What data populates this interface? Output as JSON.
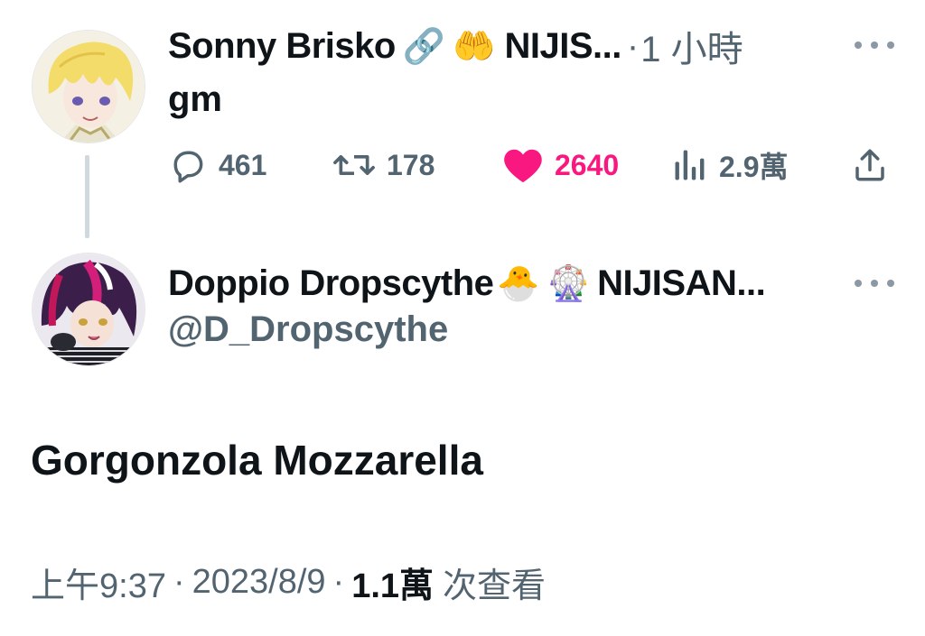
{
  "tweet1": {
    "display_name": "Sonny Brisko",
    "name_emojis": [
      "🔗",
      "🤲"
    ],
    "name_suffix": "NIJIS...",
    "separator": "·",
    "time_ago": "1 小時",
    "text": "gm",
    "more_label": "···",
    "actions": {
      "replies": "461",
      "retweets": "178",
      "likes": "2640",
      "views": "2.9萬"
    },
    "icons": [
      "reply-icon",
      "retweet-icon",
      "like-icon",
      "views-icon",
      "share-icon"
    ],
    "like_color": "#f91880"
  },
  "tweet2": {
    "display_name": "Doppio Dropscythe",
    "name_emojis": [
      "🐣",
      "🎡"
    ],
    "name_suffix": "NIJISAN...",
    "handle": "@D_Dropscythe",
    "text": "Gorgonzola Mozzarella",
    "footer": {
      "time": "上午9:37",
      "date": "2023/8/9",
      "views_count": "1.1萬",
      "views_label": "次查看"
    }
  },
  "colors": {
    "text_primary": "#0f1419",
    "text_secondary": "#536471",
    "thread_line": "#cfd9de"
  }
}
